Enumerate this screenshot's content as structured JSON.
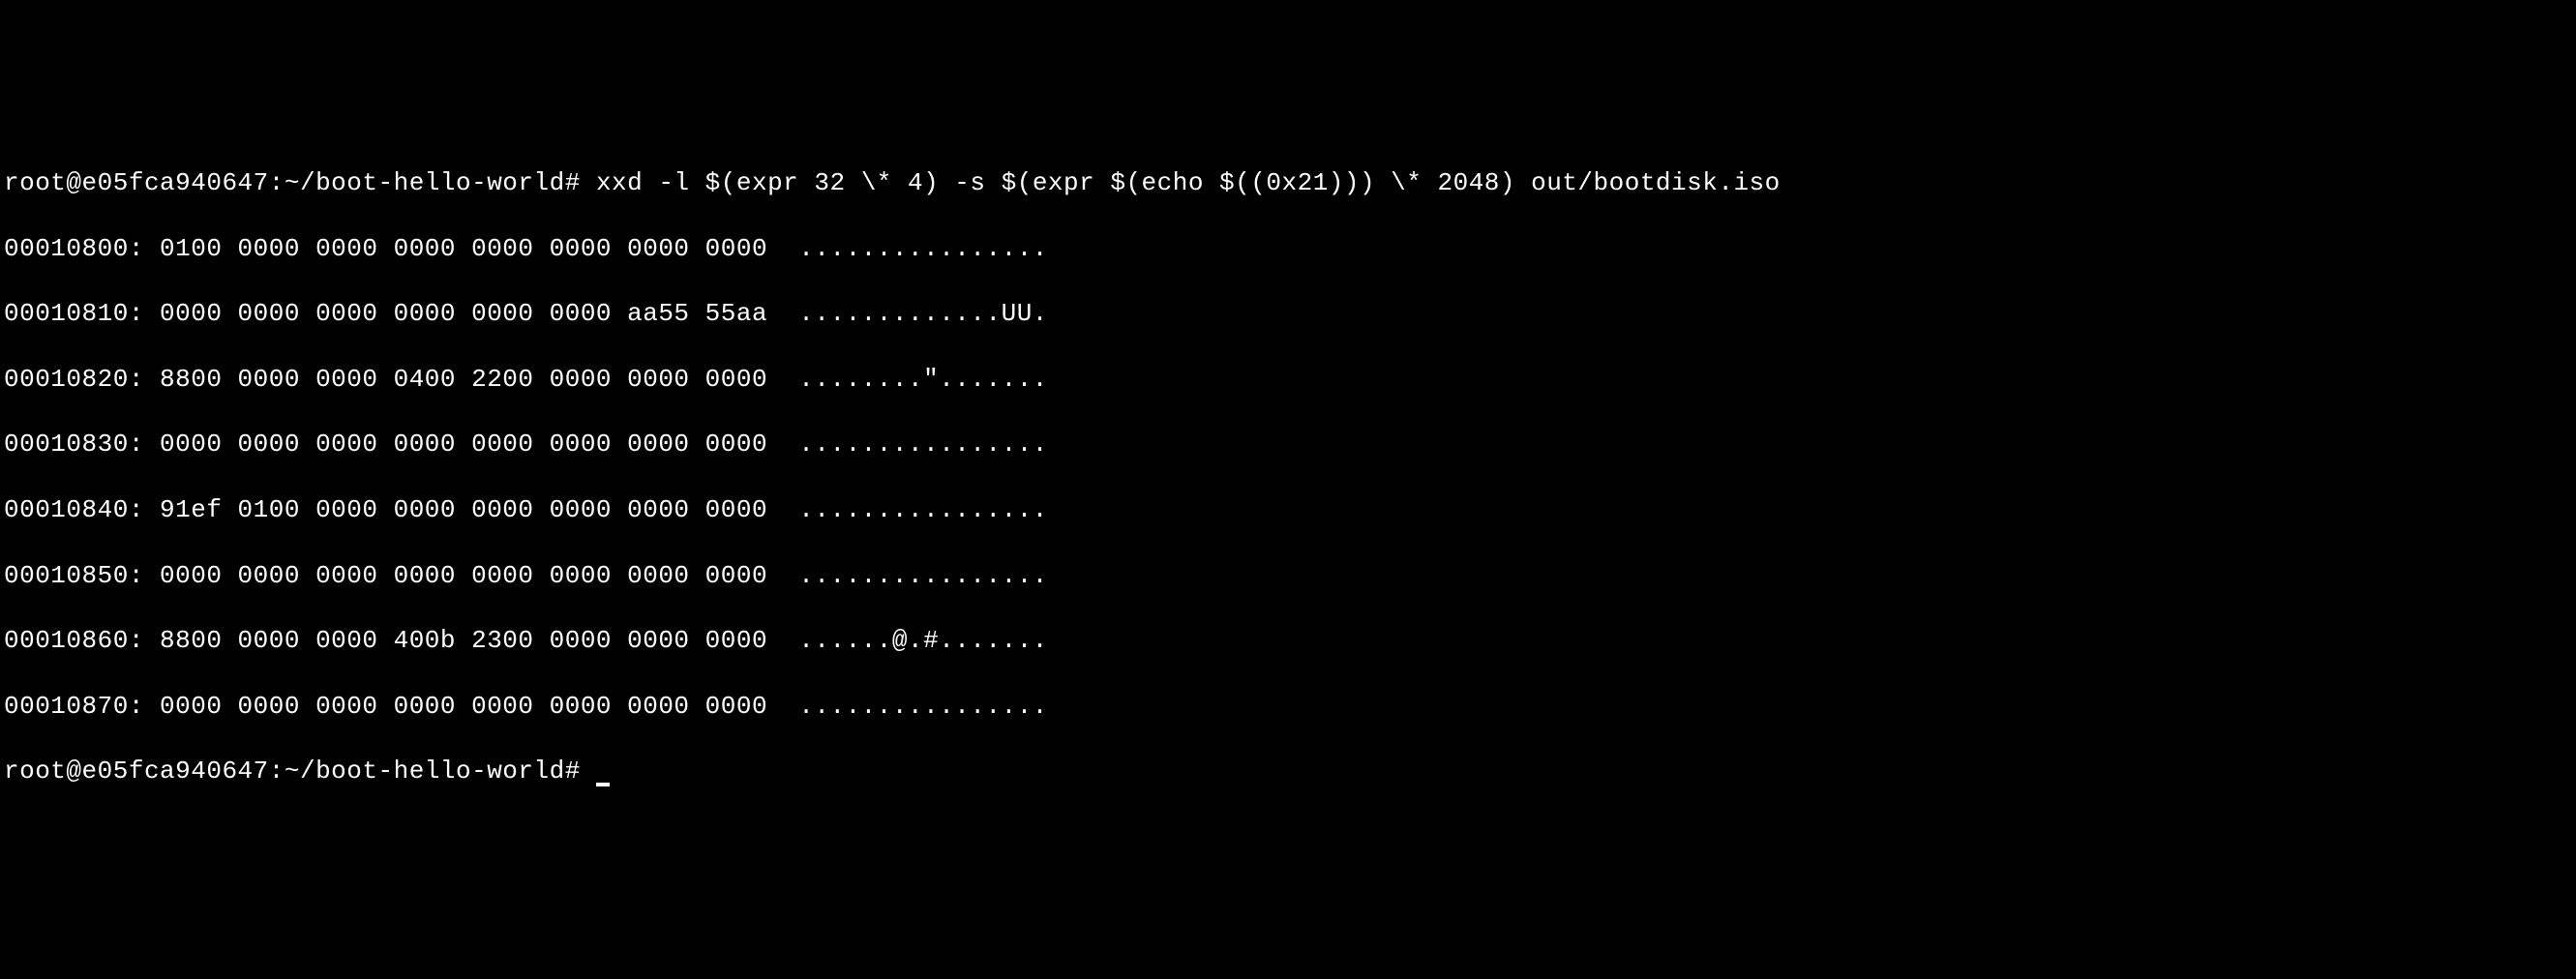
{
  "terminal": {
    "prompt_user": "root",
    "prompt_host": "e05fca940647",
    "prompt_path": "~/boot-hello-world",
    "prompt_symbol": "#",
    "command": "xxd -l $(expr 32 \\* 4) -s $(expr $(echo $((0x21))) \\* 2048) out/bootdisk.iso",
    "lines": [
      {
        "offset": "00010800:",
        "hex": "0100 0000 0000 0000 0000 0000 0000 0000",
        "ascii": "................"
      },
      {
        "offset": "00010810:",
        "hex": "0000 0000 0000 0000 0000 0000 aa55 55aa",
        "ascii": ".............UU."
      },
      {
        "offset": "00010820:",
        "hex": "8800 0000 0000 0400 2200 0000 0000 0000",
        "ascii": "........\"......."
      },
      {
        "offset": "00010830:",
        "hex": "0000 0000 0000 0000 0000 0000 0000 0000",
        "ascii": "................"
      },
      {
        "offset": "00010840:",
        "hex": "91ef 0100 0000 0000 0000 0000 0000 0000",
        "ascii": "................"
      },
      {
        "offset": "00010850:",
        "hex": "0000 0000 0000 0000 0000 0000 0000 0000",
        "ascii": "................"
      },
      {
        "offset": "00010860:",
        "hex": "8800 0000 0000 400b 2300 0000 0000 0000",
        "ascii": "......@.#......."
      },
      {
        "offset": "00010870:",
        "hex": "0000 0000 0000 0000 0000 0000 0000 0000",
        "ascii": "................"
      }
    ]
  }
}
